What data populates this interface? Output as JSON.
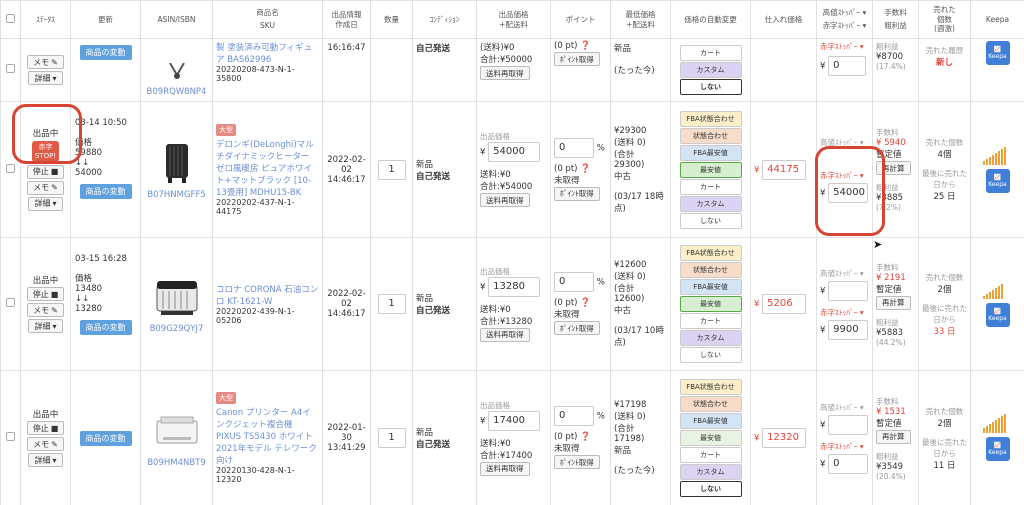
{
  "header": {
    "status": "ｽﾃｰﾀｽ",
    "updated": "更新",
    "asin": "ASIN/ISBN",
    "product_name": "商品名",
    "sku": "SKU",
    "listing_date": "出品情報\n作成日",
    "qty": "数量",
    "condition": "ｺﾝﾃﾞｨｼｮﾝ",
    "sale_price": "出品価格\n+配送料",
    "points": "ポイント",
    "lowest": "最低価格\n+配送料",
    "auto": "価格の自動変更",
    "purchase": "仕入れ価格",
    "high_stopper": "高値ｽﾄｯﾊﾟｰ",
    "red_stopper": "赤字ｽﾄｯﾊﾟｰ",
    "fee": "手数料",
    "profit": "粗利益",
    "sold": "売れた\n個数\n(週激)",
    "keepa": "Keepa"
  },
  "labels": {
    "memo": "メモ",
    "detail": "詳細",
    "stop": "停止",
    "live": "出品中",
    "change": "商品の変動",
    "fulfill": "自己発送",
    "new": "新品",
    "ship_refetch": "送料再取得",
    "pt_refetch": "ﾎﾟｲﾝﾄ取得",
    "pt_zero": "(0 pt)",
    "not_acquired": "未取得",
    "sale_price_label": "出品価格",
    "price_label": "価格",
    "recalc": "再計算",
    "provisional": "暫定値",
    "fee_label": "手数料",
    "profit_label": "粗利益",
    "sold_count_label": "売れた個数",
    "last_sold_label": "最後に売れた日から",
    "high_label": "高値ｽﾄｯﾊﾟｰ",
    "red_label": "赤字ｽﾄｯﾊﾟｰ",
    "large": "大型",
    "keepa": "Keepa",
    "percent": "%",
    "yen": "¥",
    "arrows": "↓↓",
    "history": "売れた履歴"
  },
  "auto_options": [
    "FBA状態合わせ",
    "状態合わせ",
    "FBA最安値",
    "最安値",
    "カート",
    "カスタム",
    "しない"
  ],
  "row1": {
    "asin": "B09RQW8NP4",
    "name": "製 塗装済み可動フィギュア BAS62996",
    "sku": "20220208-473-N-1-35800",
    "time": "16:16:47",
    "shipping": "(送料)¥0",
    "total": "合計:¥50000",
    "pt": "(0 pt)",
    "lowest": "新品",
    "ago": "(たった今)",
    "high": "0",
    "fee": "¥8700",
    "pct": "(17.4%)",
    "hist": "新し"
  },
  "row2": {
    "status": "出品中",
    "stop_badge": "赤字\nSTOP!",
    "updated": "03-14 10:50",
    "price": "59880",
    "price2": "54000",
    "asin": "B07HNMGFF5",
    "name": "デロンギ(DeLonghi)マルチダイナミックヒーター ゼロ風暖房 ピュアホワイト+マットブラック [10-13畳用] MDHU15-BK",
    "sku": "20220202-437-N-1-44175",
    "date": "2022-02-02",
    "time": "14:46:17",
    "qty": "1",
    "sale": "54000",
    "shipping": "送料:¥0",
    "total": "合計:¥54000",
    "pts": "0",
    "lowest": "¥29300",
    "lowest_ship": "(送料 0)",
    "lowest_total": "(合計 29300)",
    "cond": "中古",
    "ago": "(03/17 18時点)",
    "purchase": "44175",
    "red": "54000",
    "fee": "¥ 5940",
    "profit": "¥3885",
    "pct": "(7.2%)",
    "sold": "4個",
    "days": "25 日"
  },
  "row3": {
    "status": "出品中",
    "updated": "03-15 16:28",
    "price": "13480",
    "price2": "13280",
    "asin": "B09G29QYJ7",
    "name": "コロナ CORONA 石油コンロ KT-1621-W",
    "sku": "20220202-439-N-1-05206",
    "date": "2022-02-02",
    "time": "14:46:17",
    "qty": "1",
    "sale": "13280",
    "shipping": "送料:¥0",
    "total": "合計:¥13280",
    "pts": "0",
    "lowest": "¥12600",
    "lowest_ship": "(送料 0)",
    "lowest_total": "(合計 12600)",
    "cond": "中古",
    "ago": "(03/17 10時点)",
    "purchase": "5206",
    "red": "9900",
    "fee": "¥ 2191",
    "profit": "¥5883",
    "pct": "(44.2%)",
    "sold": "2個",
    "days": "33 日"
  },
  "row4": {
    "status": "出品中",
    "asin": "B09HM4NBT9",
    "name": "Canon プリンター A4インクジェット複合機 PIXUS TS5430 ホワイト 2021年モデル テレワーク向け",
    "sku": "20220130-428-N-1-12320",
    "date": "2022-01-30",
    "time": "13:41:29",
    "qty": "1",
    "sale": "17400",
    "shipping": "送料:¥0",
    "total": "合計:¥17400",
    "pts": "0",
    "lowest": "¥17198",
    "lowest_ship": "(送料 0)",
    "lowest_total": "(合計 17198)",
    "cond": "新品",
    "ago": "(たった今)",
    "purchase": "12320",
    "red": "0",
    "fee": "¥ 1531",
    "profit": "¥3549",
    "pct": "(20.4%)",
    "sold": "2個",
    "days": "11 日"
  },
  "colors": {
    "accent": "#5fa0de",
    "danger": "#e0453a",
    "circle": "#d84434"
  }
}
